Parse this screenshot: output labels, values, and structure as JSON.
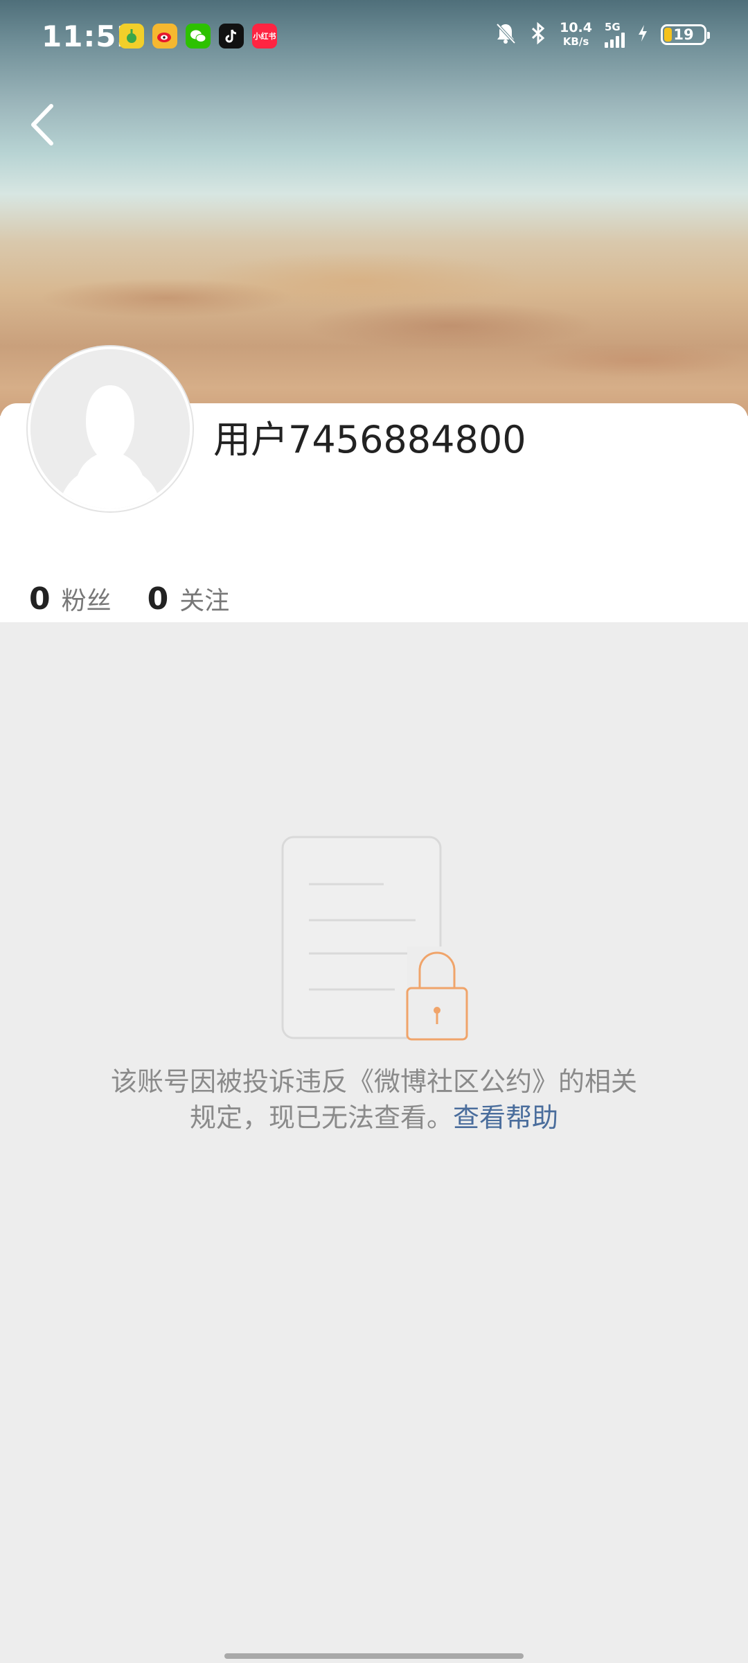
{
  "status_bar": {
    "time": "11:52",
    "net_speed_value": "10.4",
    "net_speed_unit": "KB/s",
    "network_type": "5G",
    "battery_level": "19",
    "battery_fraction": 0.19,
    "apps": [
      {
        "name": "qq-music-icon",
        "color": "#f2cf2a"
      },
      {
        "name": "weibo-icon",
        "color": "#f6b830"
      },
      {
        "name": "wechat-icon",
        "color": "#2dc100"
      },
      {
        "name": "tiktok-icon",
        "color": "#111111"
      },
      {
        "name": "xiaohongshu-icon",
        "color": "#ff2442",
        "text": "小红书"
      }
    ]
  },
  "profile": {
    "username": "用户7456884800",
    "followers_count": "0",
    "followers_label": "粉丝",
    "following_count": "0",
    "following_label": "关注"
  },
  "blocked": {
    "message_line1": "该账号因被投诉违反《微博社区公约》的相关",
    "message_line2": "规定，现已无法查看。",
    "help_link": "查看帮助"
  },
  "colors": {
    "lock_accent": "#f0a46a",
    "link": "#4a6d9c",
    "page_background": "#ededed"
  }
}
